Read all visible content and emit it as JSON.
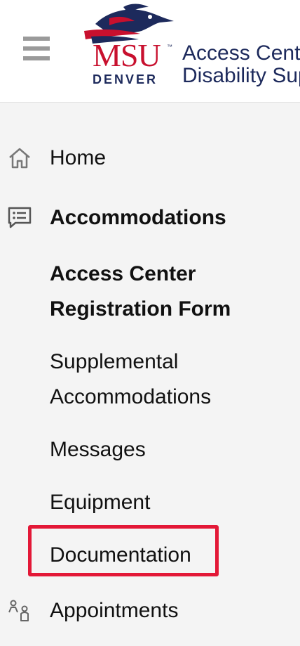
{
  "header": {
    "menu_icon": "hamburger-menu-icon",
    "logo": {
      "brand": "MSU",
      "trademark": "™",
      "sub": "DENVER",
      "mascot_icon": "roadrunner-icon"
    },
    "title_line1": "Access Center",
    "title_line2": "Disability Support"
  },
  "nav": {
    "home": {
      "label": "Home",
      "icon": "home-icon"
    },
    "accommodations": {
      "label": "Accommodations",
      "icon": "chat-list-icon"
    },
    "sub_items": {
      "registration": "Access Center Registration Form",
      "supplemental": "Supplemental Accommodations",
      "messages": "Messages",
      "equipment": "Equipment",
      "documentation": "Documentation"
    },
    "appointments": {
      "label": "Appointments",
      "icon": "people-icon"
    }
  },
  "colors": {
    "brand_red": "#c8102e",
    "brand_navy": "#1d2a5c",
    "highlight": "#e31837",
    "sidebar_bg": "#f4f4f4"
  }
}
